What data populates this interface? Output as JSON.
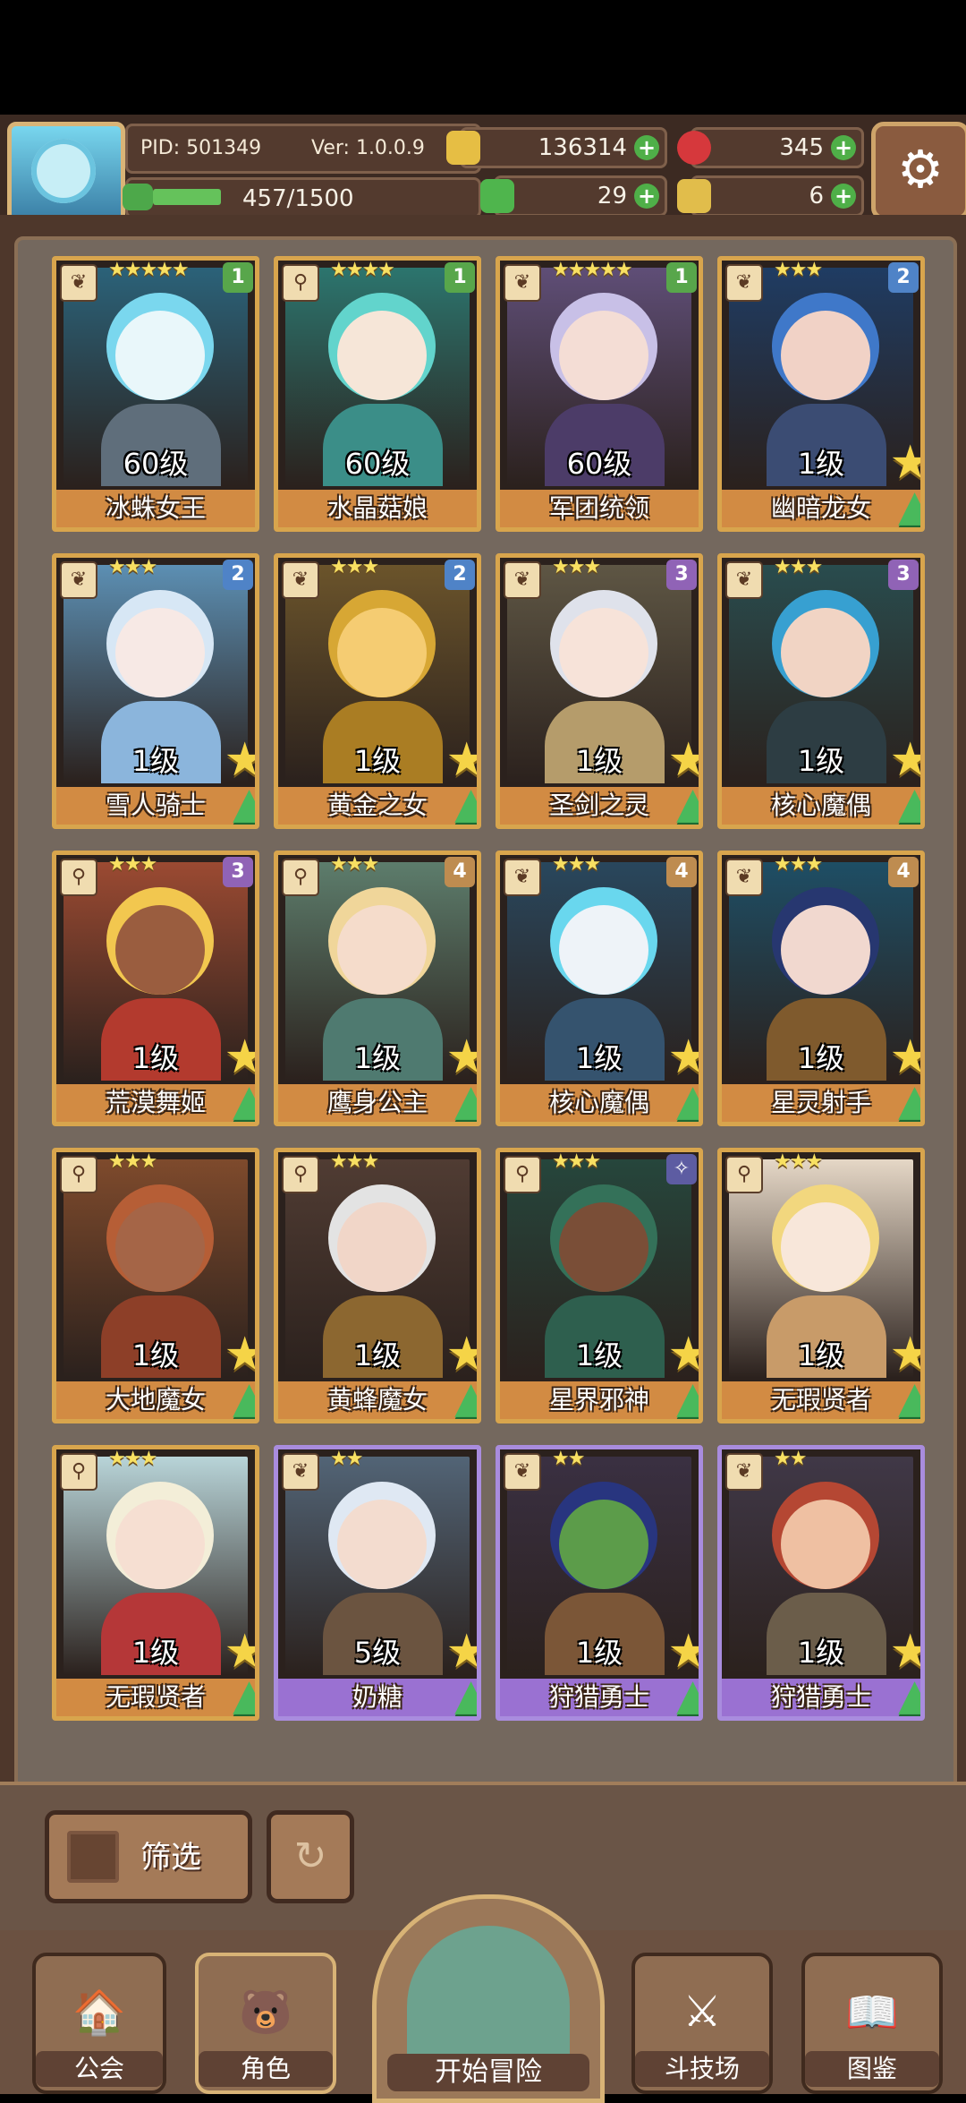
{
  "header": {
    "pid": "PID: 501349",
    "version": "Ver: 1.0.0.9",
    "xp_text": "457/1500",
    "xp_progress": 0.305,
    "currencies": [
      {
        "name": "gold-coin-icon",
        "value": "136314",
        "color": "#e6be44"
      },
      {
        "name": "red-gem-icon",
        "value": "345",
        "color": "#d6383c"
      },
      {
        "name": "clover-icon",
        "value": "29",
        "color": "#4fb54d"
      },
      {
        "name": "boot-icon",
        "value": "6",
        "color": "#e1bd4b"
      }
    ]
  },
  "cards": [
    {
      "name": "冰蛛女王",
      "level": "60级",
      "stars": "★★★★★",
      "grade": "1",
      "icon": "❦",
      "hair": "#7ad7ee",
      "skin": "#e9f7fa",
      "bg": "#2b6279",
      "body": "#5f6e7b",
      "frame": "gold",
      "big": false
    },
    {
      "name": "水晶菇娘",
      "level": "60级",
      "stars": "★★★★",
      "grade": "1",
      "icon": "⚲",
      "hair": "#62d4cc",
      "skin": "#f6e6d8",
      "bg": "#2c756e",
      "body": "#3b8e88",
      "frame": "gold",
      "big": false
    },
    {
      "name": "军团统领",
      "level": "60级",
      "stars": "★★★★★",
      "grade": "1",
      "icon": "❦",
      "hair": "#c8c0e7",
      "skin": "#f4ddd5",
      "bg": "#5f4e77",
      "body": "#4c3c68",
      "frame": "gold",
      "big": false
    },
    {
      "name": "幽暗龙女",
      "level": "1级",
      "stars": "★★★",
      "grade": "2",
      "icon": "❦",
      "hair": "#3f78c9",
      "skin": "#f1d2c6",
      "bg": "#1f3c63",
      "body": "#3b4c73",
      "frame": "gold",
      "big": true
    },
    {
      "name": "雪人骑士",
      "level": "1级",
      "stars": "★★★",
      "grade": "2",
      "icon": "❦",
      "hair": "#d7e7f5",
      "skin": "#f7e9e5",
      "bg": "#5c8fb3",
      "body": "#8bb5dc",
      "frame": "gold",
      "big": true
    },
    {
      "name": "黄金之女",
      "level": "1级",
      "stars": "★★★",
      "grade": "2",
      "icon": "❦",
      "hair": "#d7a734",
      "skin": "#f5cc72",
      "bg": "#6b542b",
      "body": "#aa7d23",
      "frame": "gold",
      "big": true
    },
    {
      "name": "圣剑之灵",
      "level": "1级",
      "stars": "★★★",
      "grade": "3",
      "icon": "❦",
      "hair": "#dfe2eb",
      "skin": "#f7e3d9",
      "bg": "#5e5644",
      "body": "#b59c6b",
      "frame": "gold",
      "big": true
    },
    {
      "name": "核心魔偶",
      "level": "1级",
      "stars": "★★★",
      "grade": "3",
      "icon": "❦",
      "hair": "#37a0d1",
      "skin": "#f1d4c4",
      "bg": "#294c4e",
      "body": "#2d3d43",
      "frame": "gold",
      "big": true
    },
    {
      "name": "荒漠舞姬",
      "level": "1级",
      "stars": "★★★",
      "grade": "3",
      "icon": "⚲",
      "hair": "#f2c74f",
      "skin": "#9a5d3f",
      "bg": "#9b4a32",
      "body": "#b33a2e",
      "frame": "gold",
      "big": true
    },
    {
      "name": "鹰身公主",
      "level": "1级",
      "stars": "★★★",
      "grade": "4",
      "icon": "⚲",
      "hair": "#f0d69a",
      "skin": "#f5dccb",
      "bg": "#5d7d6c",
      "body": "#4f7a70",
      "frame": "gold",
      "big": true
    },
    {
      "name": "核心魔偶",
      "level": "1级",
      "stars": "★★★",
      "grade": "4",
      "icon": "❦",
      "hair": "#69d7ee",
      "skin": "#eef3f8",
      "bg": "#29475d",
      "body": "#35536e",
      "frame": "gold",
      "big": true
    },
    {
      "name": "星灵射手",
      "level": "1级",
      "stars": "★★★",
      "grade": "4",
      "icon": "❦",
      "hair": "#273770",
      "skin": "#f1d8cf",
      "bg": "#1e4e65",
      "body": "#7f5a2d",
      "frame": "gold",
      "big": true
    },
    {
      "name": "大地魔女",
      "level": "1级",
      "stars": "★★★",
      "grade": "",
      "icon": "⚲",
      "hair": "#b65e36",
      "skin": "#a56547",
      "bg": "#7e4a2c",
      "body": "#8d3f28",
      "frame": "gold",
      "big": true
    },
    {
      "name": "黄蜂魔女",
      "level": "1级",
      "stars": "★★★",
      "grade": "",
      "icon": "⚲",
      "hair": "#e3e3e3",
      "skin": "#f1d6c8",
      "bg": "#503c33",
      "body": "#8c6730",
      "frame": "gold",
      "big": true
    },
    {
      "name": "星界邪神",
      "level": "1级",
      "stars": "★★★",
      "grade": "✧",
      "icon": "⚲",
      "hair": "#347159",
      "skin": "#7a4e37",
      "bg": "#26463c",
      "body": "#2e5f4e",
      "frame": "gold",
      "big": true
    },
    {
      "name": "无瑕贤者",
      "level": "1级",
      "stars": "★★★",
      "grade": "",
      "icon": "⚲",
      "hair": "#f2d77e",
      "skin": "#f8e7da",
      "bg": "#e5d7c6",
      "body": "#c89b69",
      "frame": "gold",
      "big": true
    },
    {
      "name": "无瑕贤者",
      "level": "1级",
      "stars": "★★★",
      "grade": "",
      "icon": "⚲",
      "hair": "#f3eed8",
      "skin": "#f6dfd2",
      "bg": "#b8d4d8",
      "body": "#b53738",
      "frame": "gold",
      "big": true
    },
    {
      "name": "奶糖",
      "level": "5级",
      "stars": "★★",
      "grade": "",
      "icon": "❦",
      "hair": "#dfe8f3",
      "skin": "#f3dccf",
      "bg": "#526476",
      "body": "#6b5440",
      "frame": "purple",
      "big": true
    },
    {
      "name": "狩猎勇士",
      "level": "1级",
      "stars": "★★",
      "grade": "",
      "icon": "❦",
      "hair": "#28357f",
      "skin": "#5c9c4a",
      "bg": "#3a3042",
      "body": "#7b5637",
      "frame": "purple",
      "big": true
    },
    {
      "name": "狩猎勇士",
      "level": "1级",
      "stars": "★★",
      "grade": "",
      "icon": "❦",
      "hair": "#b54733",
      "skin": "#efc0a2",
      "bg": "#403847",
      "body": "#6b5d4a",
      "frame": "purple",
      "big": true
    }
  ],
  "controls": {
    "filter_label": "筛选"
  },
  "nav": {
    "guild": "公会",
    "character": "角色",
    "adventure": "开始冒险",
    "arena": "斗技场",
    "codex": "图鉴"
  }
}
